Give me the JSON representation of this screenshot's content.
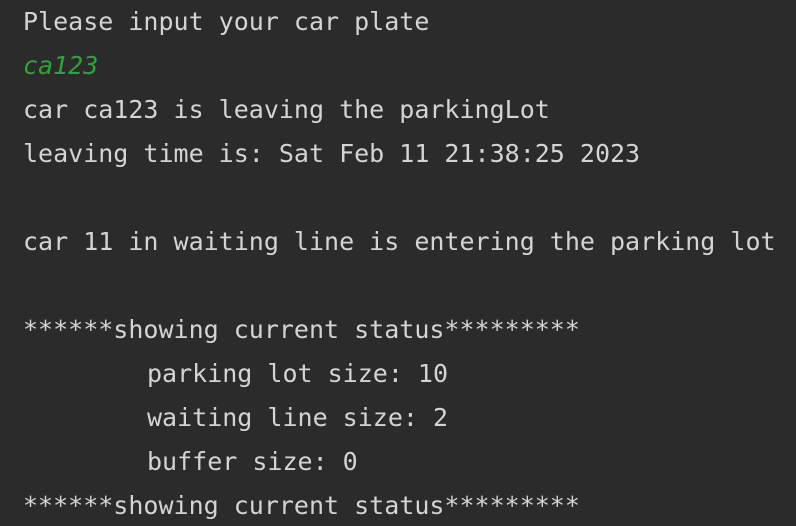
{
  "console": {
    "prompt": "Please input your car plate",
    "user_input": "ca123",
    "leaving_msg": "car ca123 is leaving the parkingLot",
    "leaving_time": "leaving time is: Sat Feb 11 21:38:25 2023",
    "entering_msg": "car 11 in waiting line is entering the parking lot",
    "status_header": "******showing current status*********",
    "parking_lot_size": "parking lot size: 10",
    "waiting_line_size": "waiting line size: 2",
    "buffer_size": "buffer size: 0",
    "status_footer": "******showing current status*********"
  },
  "colors": {
    "background": "#2b2b2b",
    "text": "#d4d4d4",
    "input": "#2fa33a"
  }
}
